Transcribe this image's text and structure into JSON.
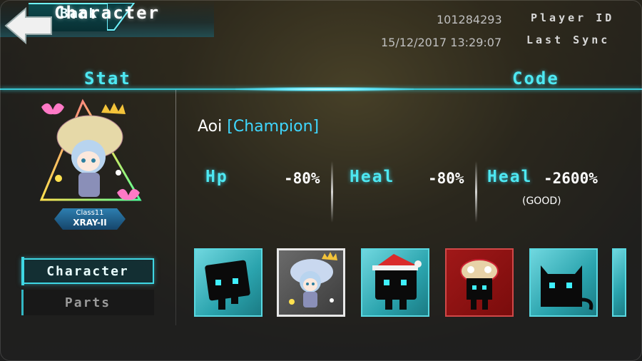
{
  "header": {
    "back_label": "Back",
    "player_id_value": "101284293",
    "player_id_label": "Player ID",
    "last_sync_value": "15/12/2017 13:29:07",
    "last_sync_label": "Last Sync"
  },
  "tabs": {
    "stat": "Stat",
    "character": "Character",
    "code": "Code"
  },
  "portrait": {
    "class_line1": "Class11",
    "class_line2": "XRAY-II"
  },
  "side_menu": {
    "character": "Character",
    "parts": "Parts"
  },
  "character": {
    "name": "Aoi",
    "title": "[Champion]"
  },
  "stats": [
    {
      "label": "Hp",
      "value": "-80%"
    },
    {
      "label": "Heal",
      "value": "-80%"
    },
    {
      "label": "Heal",
      "value": "-2600%",
      "note": "(GOOD)"
    }
  ],
  "cards": [
    {
      "name": "black-box-character",
      "style": "teal"
    },
    {
      "name": "aoi-character",
      "style": "selected"
    },
    {
      "name": "santa-hat-character",
      "style": "teal"
    },
    {
      "name": "lion-dance-character",
      "style": "red"
    },
    {
      "name": "black-cat-character",
      "style": "teal"
    }
  ],
  "colors": {
    "accent_cyan": "#4ee8f2",
    "title_blue": "#3fd7ff",
    "card_red": "#a01818"
  }
}
